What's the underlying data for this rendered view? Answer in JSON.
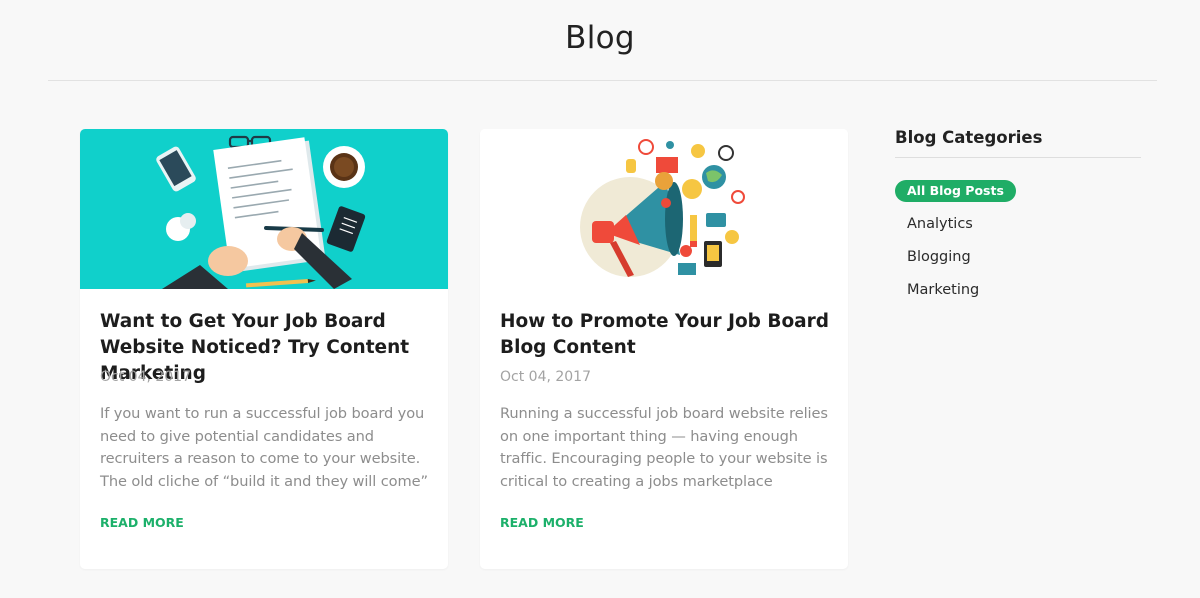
{
  "page": {
    "title": "Blog"
  },
  "colors": {
    "accent": "#1fad66",
    "read_more": "#1cb06a",
    "card1_bg": "#10d0cb"
  },
  "posts": [
    {
      "image_icon": "writing-desk-illustration",
      "title": "Want to Get Your Job Board Website Noticed? Try Content Marketing",
      "date": "Oct 04, 2017",
      "excerpt": "If you want to run a successful job board you need to give potential candidates and recruiters a reason to come to your website. The old cliche of “build it and they will come”",
      "read_more": "READ MORE"
    },
    {
      "image_icon": "megaphone-illustration",
      "title": "How to Promote Your Job Board Blog Content",
      "date": "Oct 04, 2017",
      "excerpt": "Running a successful job board website relies on one important thing — having enough traffic. Encouraging people to your website is critical to creating a jobs marketplace",
      "read_more": "READ MORE"
    }
  ],
  "sidebar": {
    "heading": "Blog Categories",
    "categories": [
      {
        "label": "All Blog Posts",
        "active": true
      },
      {
        "label": "Analytics",
        "active": false
      },
      {
        "label": "Blogging",
        "active": false
      },
      {
        "label": "Marketing",
        "active": false
      }
    ]
  }
}
